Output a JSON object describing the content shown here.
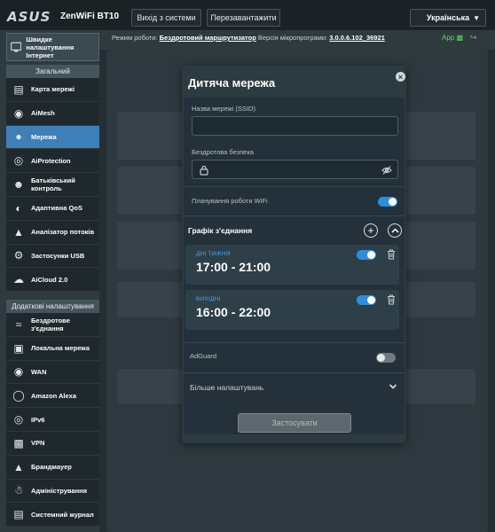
{
  "header": {
    "logo": "ASUS",
    "model": "ZenWiFi BT10",
    "logout_label": "Вихід з системи",
    "reboot_label": "Перезавантажити",
    "language": "Українська"
  },
  "status": {
    "mode_label": "Режим роботи:",
    "mode_value": "Бездротовий маршрутизатор",
    "firmware_label": "Версія мікропрограми:",
    "firmware_value": "3.0.0.6.102_36921",
    "app_label": "App"
  },
  "sidebar": {
    "quick_setup": "Швидке налаштування Інтернет",
    "general_header": "Загальний",
    "general_items": [
      {
        "label": "Карта мережі",
        "icon": "network-map-icon"
      },
      {
        "label": "AiMesh",
        "icon": "aimesh-icon"
      },
      {
        "label": "Мережа",
        "icon": "network-icon",
        "active": true
      },
      {
        "label": "AiProtection",
        "icon": "aiprotection-icon"
      },
      {
        "label": "Батьківський контроль",
        "icon": "parental-control-icon"
      },
      {
        "label": "Адаптивна QoS",
        "icon": "qos-icon"
      },
      {
        "label": "Аналізатор потоків",
        "icon": "traffic-analyzer-icon"
      },
      {
        "label": "Застосунки USB",
        "icon": "usb-apps-icon"
      },
      {
        "label": "AiCloud 2.0",
        "icon": "aicloud-icon"
      }
    ],
    "advanced_header": "Додаткові налаштування",
    "advanced_items": [
      {
        "label": "Бездротове з'єднання",
        "icon": "wireless-icon"
      },
      {
        "label": "Локальна мережа",
        "icon": "lan-icon"
      },
      {
        "label": "WAN",
        "icon": "wan-icon"
      },
      {
        "label": "Amazon Alexa",
        "icon": "alexa-icon"
      },
      {
        "label": "IPv6",
        "icon": "ipv6-icon"
      },
      {
        "label": "VPN",
        "icon": "vpn-icon"
      },
      {
        "label": "Брандмауер",
        "icon": "firewall-icon"
      },
      {
        "label": "Адміністрування",
        "icon": "administration-icon"
      },
      {
        "label": "Системний журнал",
        "icon": "system-log-icon"
      }
    ]
  },
  "modal": {
    "title": "Дитяча мережа",
    "ssid_label": "Назва мережі (SSID)",
    "ssid_value": "",
    "security_label": "Бездротова безпека",
    "security_value": "",
    "wifi_schedule_label": "Планування роботи WiFi",
    "wifi_schedule_on": true,
    "schedule_title": "Графік з'єднання",
    "schedules": [
      {
        "days": "ДНІ ТИЖНЯ",
        "time": "17:00 - 21:00",
        "enabled": true
      },
      {
        "days": "ВИХІДНІ",
        "time": "16:00 - 22:00",
        "enabled": true
      }
    ],
    "adguard_label": "AdGuard",
    "adguard_on": false,
    "more_settings_label": "Більше налаштувань",
    "apply_label": "Застосувати"
  },
  "colors": {
    "accent": "#2d8fdc",
    "active_nav": "#3e7fb8",
    "day_label": "#49a7f0"
  }
}
